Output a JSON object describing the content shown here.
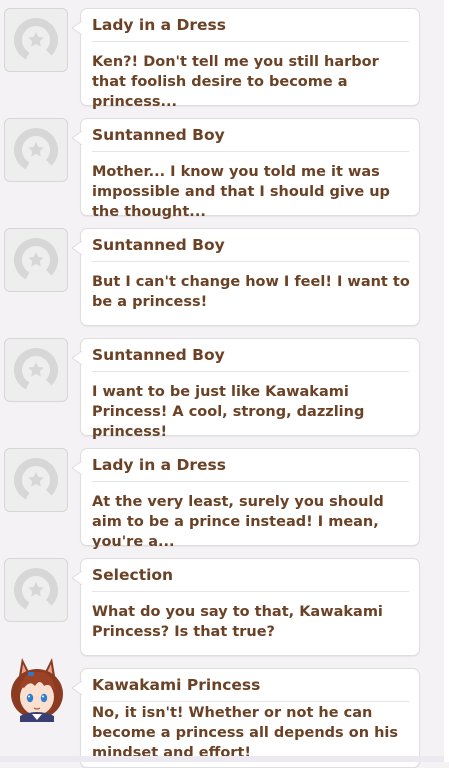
{
  "colors": {
    "text": "#6b4226",
    "bubble": "#ffffff",
    "background": "#f4f2f5"
  },
  "messages": [
    {
      "speaker": "Lady in a Dress",
      "text": "Ken?! Don't tell me you still harbor that foolish desire to become a princess...",
      "avatar": "horseshoe-placeholder-icon"
    },
    {
      "speaker": "Suntanned Boy",
      "text": "Mother... I know you told me it was impossible and that I should give up the thought...",
      "avatar": "horseshoe-placeholder-icon"
    },
    {
      "speaker": "Suntanned Boy",
      "text": "But I can't change how I feel! I want to be a princess!",
      "avatar": "horseshoe-placeholder-icon"
    },
    {
      "speaker": "Suntanned Boy",
      "text": "I want to be just like Kawakami Princess! A cool, strong, dazzling princess!",
      "avatar": "horseshoe-placeholder-icon"
    },
    {
      "speaker": "Lady in a Dress",
      "text": "At the very least, surely you should aim to be a prince instead! I mean, you're a...",
      "avatar": "horseshoe-placeholder-icon"
    },
    {
      "speaker": "Selection",
      "text": "What do you say to that, Kawakami Princess? Is that true?",
      "avatar": "horseshoe-placeholder-icon"
    },
    {
      "speaker": "Kawakami Princess",
      "text": "No, it isn't! Whether or not he can become a princess all depends on his mindset and effort!",
      "avatar": "kawakami-princess-portrait"
    }
  ]
}
